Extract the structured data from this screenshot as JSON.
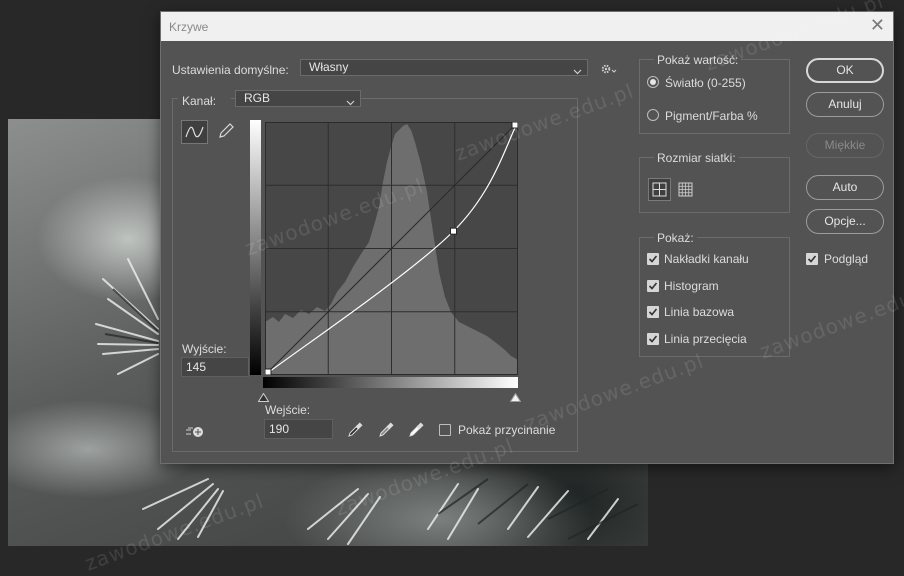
{
  "dialog": {
    "title": "Krzywe",
    "preset_label": "Ustawienia domyślne:",
    "preset_value": "Własny",
    "channel_label": "Kanał:",
    "channel_value": "RGB",
    "output_label": "Wyjście:",
    "output_value": "145",
    "input_label": "Wejście:",
    "input_value": "190",
    "show_clipping_label": "Pokaż przycinanie"
  },
  "show_amount": {
    "legend": "Pokaż wartość:",
    "options": [
      {
        "label": "Światło (0-255)",
        "selected": true
      },
      {
        "label": "Pigment/Farba %",
        "selected": false
      }
    ]
  },
  "grid_size": {
    "legend": "Rozmiar siatki:"
  },
  "show": {
    "legend": "Pokaż:",
    "options": [
      {
        "label": "Nakładki kanału",
        "checked": true
      },
      {
        "label": "Histogram",
        "checked": true
      },
      {
        "label": "Linia bazowa",
        "checked": true
      },
      {
        "label": "Linia przecięcia",
        "checked": true
      }
    ]
  },
  "buttons": {
    "ok": "OK",
    "cancel": "Anuluj",
    "smooth": "Miękkie",
    "auto": "Auto",
    "options": "Opcje..."
  },
  "preview_label": "Podgląd",
  "curve": {
    "points": [
      [
        0,
        0
      ],
      [
        190,
        145
      ],
      [
        255,
        255
      ]
    ]
  },
  "watermark": "zawodowe.edu.pl",
  "colors": {
    "dialog_bg": "#535353",
    "graph_bg": "#474747",
    "histogram": "#6e6e6e",
    "curve": "#ffffff"
  },
  "icons": [
    "curve-tool-icon",
    "pencil-icon",
    "settings-gear-icon",
    "hand-target-icon",
    "black-point-eyedropper-icon",
    "gray-point-eyedropper-icon",
    "white-point-eyedropper-icon",
    "grid-simple-icon",
    "grid-detailed-icon"
  ]
}
